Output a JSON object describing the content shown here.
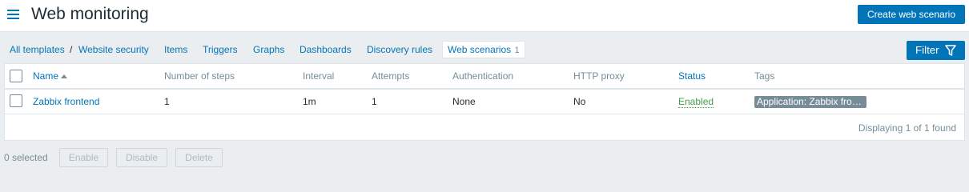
{
  "header": {
    "title": "Web monitoring",
    "create_button": "Create web scenario"
  },
  "nav": {
    "all_templates": "All templates",
    "separator": "/",
    "template_name": "Website security",
    "items": "Items",
    "triggers": "Triggers",
    "graphs": "Graphs",
    "dashboards": "Dashboards",
    "discovery_rules": "Discovery rules",
    "web_scenarios": "Web scenarios",
    "web_scenarios_count": "1"
  },
  "filter": {
    "label": "Filter",
    "icon": "funnel-icon"
  },
  "table": {
    "headers": {
      "name": "Name",
      "steps": "Number of steps",
      "interval": "Interval",
      "attempts": "Attempts",
      "authentication": "Authentication",
      "http_proxy": "HTTP proxy",
      "status": "Status",
      "tags": "Tags"
    },
    "rows": [
      {
        "name": "Zabbix frontend",
        "steps": "1",
        "interval": "1m",
        "attempts": "1",
        "authentication": "None",
        "http_proxy": "No",
        "status": "Enabled",
        "tag": "Application: Zabbix fro…"
      }
    ],
    "footer": "Displaying 1 of 1 found"
  },
  "actions": {
    "selected": "0 selected",
    "enable": "Enable",
    "disable": "Disable",
    "delete": "Delete"
  },
  "colors": {
    "accent": "#0275b8",
    "enabled": "#429e47",
    "muted": "#768d99",
    "background": "#ebeef0"
  }
}
